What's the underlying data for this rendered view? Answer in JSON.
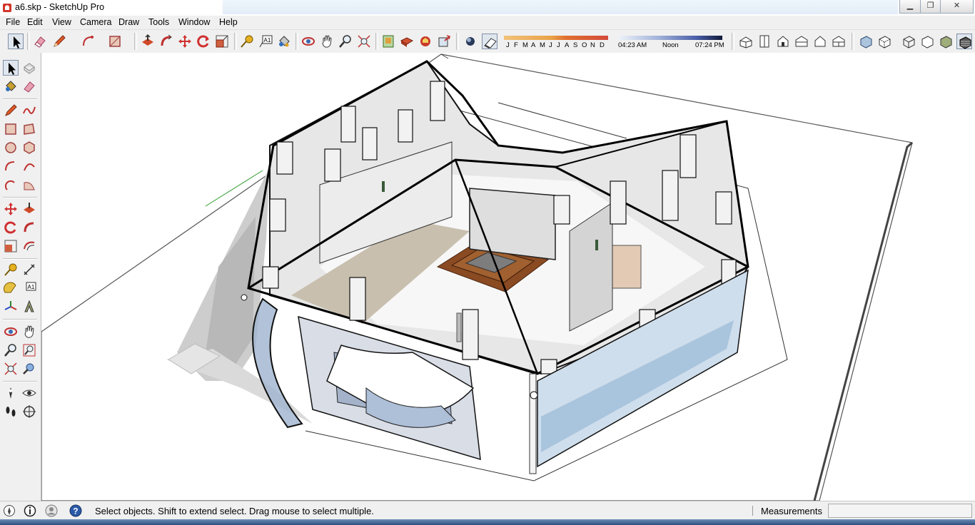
{
  "window": {
    "title": "a6.skp - SketchUp Pro",
    "minimize_label": "▁",
    "restore_label": "❐",
    "close_label": "✕"
  },
  "menu": {
    "items": [
      "File",
      "Edit",
      "View",
      "Camera",
      "Draw",
      "Tools",
      "Window",
      "Help"
    ]
  },
  "toolbar": {
    "tools": [
      "select-tool",
      "eraser-tool",
      "pencil-tool",
      "arc-tool",
      "rectangle-tool",
      "push-pull-tool",
      "follow-me-tool",
      "move-tool",
      "rotate-tool",
      "scale-tool",
      "tape-measure-tool",
      "text-tool",
      "paint-bucket-tool",
      "orbit-tool",
      "pan-tool",
      "zoom-tool",
      "zoom-extents-tool",
      "model-info-tool",
      "components-tool",
      "3d-warehouse-tool",
      "share-model-tool",
      "shadows-toggle",
      "fog-toggle"
    ],
    "views": [
      "iso-view",
      "top-view",
      "front-view",
      "right-view",
      "back-view",
      "left-view"
    ],
    "styles": [
      "xray-style",
      "back-edges-style",
      "wireframe-style",
      "hidden-line-style",
      "shaded-style",
      "shaded-textures-style"
    ]
  },
  "shadows": {
    "months": [
      "J",
      "F",
      "M",
      "A",
      "M",
      "J",
      "J",
      "A",
      "S",
      "O",
      "N",
      "D"
    ],
    "time_start": "04:23 AM",
    "time_mid": "Noon",
    "time_end": "07:24 PM"
  },
  "left_tools": [
    "select",
    "component",
    "paint-bucket",
    "eraser",
    "line",
    "freehand",
    "rectangle",
    "rotated-rectangle",
    "circle",
    "polygon",
    "arc",
    "arc-2point",
    "arc-3point",
    "pie",
    "move",
    "push-pull",
    "rotate",
    "follow-me",
    "scale",
    "offset",
    "tape-measure",
    "dimension",
    "protractor",
    "text",
    "axes",
    "3d-text",
    "orbit",
    "pan",
    "zoom",
    "zoom-window",
    "zoom-extents",
    "previous",
    "position-camera",
    "look-around",
    "walk",
    "section-plane"
  ],
  "status": {
    "text": "Select objects. Shift to extend select. Drag mouse to select multiple.",
    "measurements_label": "Measurements",
    "measurements_value": ""
  },
  "colors": {
    "accent": "#7f8fa6",
    "ground": "#ffffff",
    "glass": "#b8c8dc",
    "floor_wood": "#8a4a22",
    "pool_blue": "#a9c4dd"
  }
}
